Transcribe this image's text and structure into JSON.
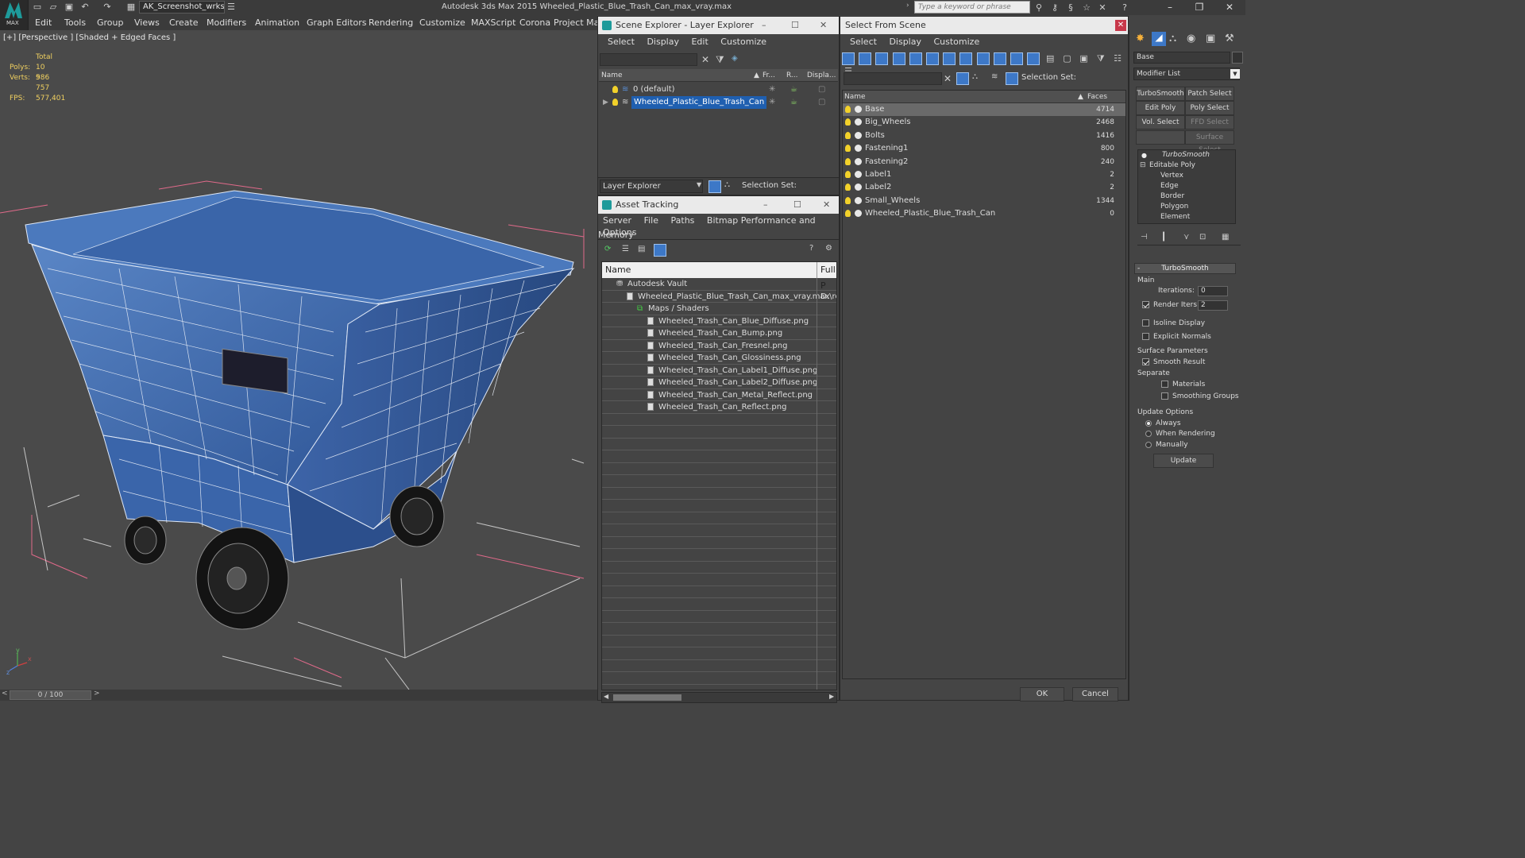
{
  "app": {
    "title": "Autodesk 3ds Max  2015     Wheeled_Plastic_Blue_Trash_Can_max_vray.max",
    "logo_text": "MAX",
    "workspace": "AK_Screenshot_wrksp",
    "search_placeholder": "Type a keyword or phrase",
    "menus": [
      "Edit",
      "Tools",
      "Group",
      "Views",
      "Create",
      "Modifiers",
      "Animation",
      "Graph Editors",
      "Rendering",
      "Customize",
      "MAXScript",
      "Corona",
      "Project Man"
    ]
  },
  "viewport": {
    "label": "[+] [Perspective ] [Shaded + Edged Faces ]",
    "stats": {
      "total_label": "Total",
      "polys_label": "Polys:",
      "polys": "10 986",
      "verts_label": "Verts:",
      "verts": "5 757",
      "fps_label": "FPS:",
      "fps": "577,401"
    },
    "axis_labels": {
      "x": "x",
      "y": "y",
      "z": "z"
    }
  },
  "timeline": {
    "frame": "0 / 100",
    "prev": "<",
    "next": ">"
  },
  "scene_explorer": {
    "title": "Scene Explorer - Layer Explorer",
    "menus": [
      "Select",
      "Display",
      "Edit",
      "Customize"
    ],
    "columns": [
      "Name",
      "Fr...",
      "R...",
      "Displa..."
    ],
    "rows": [
      {
        "name": "0 (default)",
        "selected": false
      },
      {
        "name": "Wheeled_Plastic_Blue_Trash_Can",
        "selected": true
      }
    ],
    "footer_combo": "Layer Explorer",
    "selection_set_label": "Selection Set:"
  },
  "asset_tracking": {
    "title": "Asset Tracking",
    "menus": [
      "Server",
      "File",
      "Paths",
      "Bitmap Performance and Memory"
    ],
    "menus2": [
      "Options"
    ],
    "columns": [
      "Name",
      "Full P"
    ],
    "tree": [
      {
        "name": "Autodesk Vault",
        "level": 0,
        "path": ""
      },
      {
        "name": "Wheeled_Plastic_Blue_Trash_Can_max_vray.max",
        "level": 1,
        "path": "D:\\re"
      },
      {
        "name": "Maps / Shaders",
        "level": 2,
        "path": ""
      },
      {
        "name": "Wheeled_Trash_Can_Blue_Diffuse.png",
        "level": 3,
        "path": ""
      },
      {
        "name": "Wheeled_Trash_Can_Bump.png",
        "level": 3,
        "path": ""
      },
      {
        "name": "Wheeled_Trash_Can_Fresnel.png",
        "level": 3,
        "path": ""
      },
      {
        "name": "Wheeled_Trash_Can_Glossiness.png",
        "level": 3,
        "path": ""
      },
      {
        "name": "Wheeled_Trash_Can_Label1_Diffuse.png",
        "level": 3,
        "path": ""
      },
      {
        "name": "Wheeled_Trash_Can_Label2_Diffuse.png",
        "level": 3,
        "path": ""
      },
      {
        "name": "Wheeled_Trash_Can_Metal_Reflect.png",
        "level": 3,
        "path": ""
      },
      {
        "name": "Wheeled_Trash_Can_Reflect.png",
        "level": 3,
        "path": ""
      }
    ]
  },
  "select_from_scene": {
    "title": "Select From Scene",
    "menus": [
      "Select",
      "Display",
      "Customize"
    ],
    "selection_set_label": "Selection Set:",
    "columns": [
      "Name",
      "Faces"
    ],
    "rows": [
      {
        "name": "Base",
        "faces": "4714",
        "selected": true
      },
      {
        "name": "Big_Wheels",
        "faces": "2468",
        "selected": false
      },
      {
        "name": "Bolts",
        "faces": "1416",
        "selected": false
      },
      {
        "name": "Fastening1",
        "faces": "800",
        "selected": false
      },
      {
        "name": "Fastening2",
        "faces": "240",
        "selected": false
      },
      {
        "name": "Label1",
        "faces": "2",
        "selected": false
      },
      {
        "name": "Label2",
        "faces": "2",
        "selected": false
      },
      {
        "name": "Small_Wheels",
        "faces": "1344",
        "selected": false
      },
      {
        "name": "Wheeled_Plastic_Blue_Trash_Can",
        "faces": "0",
        "selected": false
      }
    ],
    "ok": "OK",
    "cancel": "Cancel"
  },
  "command_panel": {
    "object_name": "Base",
    "modifier_list": "Modifier List",
    "buttons": [
      "TurboSmooth",
      "Patch Select",
      "Edit Poly",
      "Poly Select",
      "Vol. Select",
      "FFD Select",
      "",
      "Surface Select"
    ],
    "stack": [
      {
        "name": "TurboSmooth",
        "level": 0,
        "italic": true
      },
      {
        "name": "Editable Poly",
        "level": 0,
        "italic": false
      },
      {
        "name": "Vertex",
        "level": 1,
        "italic": false
      },
      {
        "name": "Edge",
        "level": 1,
        "italic": false
      },
      {
        "name": "Border",
        "level": 1,
        "italic": false
      },
      {
        "name": "Polygon",
        "level": 1,
        "italic": false
      },
      {
        "name": "Element",
        "level": 1,
        "italic": false
      }
    ],
    "rollout_title": "TurboSmooth",
    "main_label": "Main",
    "iterations_label": "Iterations:",
    "iterations": "0",
    "render_iters_label": "Render Iters:",
    "render_iters": "2",
    "isoline": "Isoline Display",
    "explicit": "Explicit Normals",
    "surface_params": "Surface Parameters",
    "smooth_result": "Smooth Result",
    "separate": "Separate",
    "materials": "Materials",
    "smoothing_groups": "Smoothing Groups",
    "update_options": "Update Options",
    "always": "Always",
    "when_rendering": "When Rendering",
    "manually": "Manually",
    "update": "Update"
  },
  "colors": {
    "accent": "#3d78c7",
    "selection": "#1f5fb0",
    "bg": "#444444"
  }
}
